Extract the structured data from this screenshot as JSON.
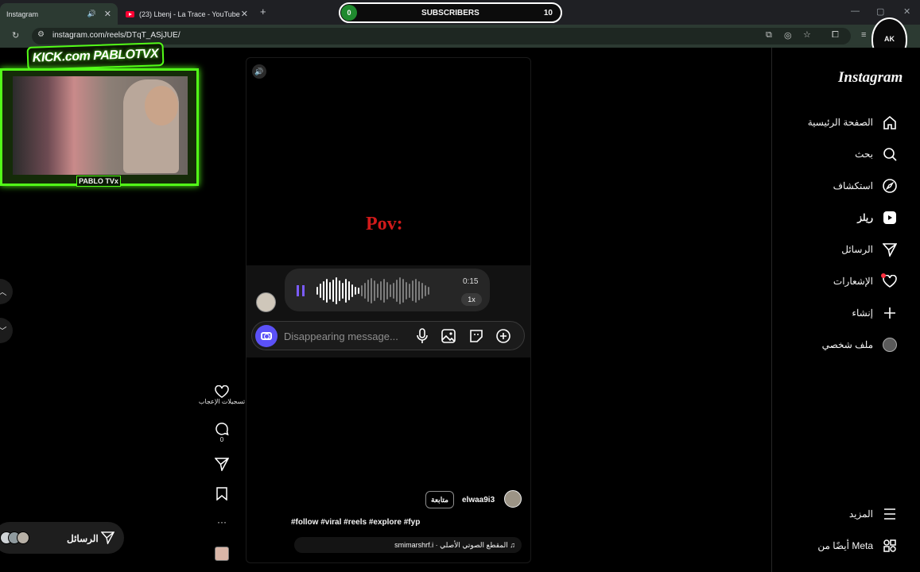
{
  "browser": {
    "tabs": [
      {
        "title": "Instagram"
      },
      {
        "title": "(23) Lbenj - La Trace - YouTube"
      }
    ],
    "new_tab": "+",
    "url": "instagram.com/reels/DTqT_ASjJUE/"
  },
  "overlay": {
    "subscribers_label": "SUBSCRIBERS",
    "subscribers_start": "0",
    "subscribers_goal": "10",
    "subscribers_progress": 0,
    "kick_logo": "KICK.com PABLOTVX",
    "cam_label": "PABLO TVx",
    "badge": "AK"
  },
  "reel": {
    "caption_text": "Pov:",
    "voice_duration": "0:15",
    "voice_speed": "1x",
    "message_placeholder": "Disappearing message...",
    "follow_label": "متابعة",
    "username": "elwaa9i3",
    "hashtags": "#follow #viral #reels #explore #fyp",
    "audio": "smimarshrf.i · المقطع الصوتي الأصلي ♫"
  },
  "actions": {
    "likes_label": "تسجيلات الإعجاب",
    "comments_count": "0",
    "more": "···"
  },
  "messages_pill": {
    "label": "الرسائل"
  },
  "sidebar": {
    "logo": "Instagram",
    "items": [
      {
        "label": "الصفحة الرئيسية",
        "icon": "home-icon"
      },
      {
        "label": "بحث",
        "icon": "search-icon"
      },
      {
        "label": "استكشاف",
        "icon": "compass-icon"
      },
      {
        "label": "ريلز",
        "icon": "reels-icon"
      },
      {
        "label": "الرسائل",
        "icon": "send-icon"
      },
      {
        "label": "الإشعارات",
        "icon": "heart-icon"
      },
      {
        "label": "إنشاء",
        "icon": "plus-icon"
      },
      {
        "label": "ملف شخصي",
        "icon": "profile-icon"
      }
    ],
    "more_label": "المزيد",
    "meta_label": "أيضًا من Meta"
  },
  "colors": {
    "kick_green": "#53fc18",
    "ig_accent": "#5b51f7",
    "notif_red": "#ff3040",
    "pov_red": "#d11a1a"
  }
}
